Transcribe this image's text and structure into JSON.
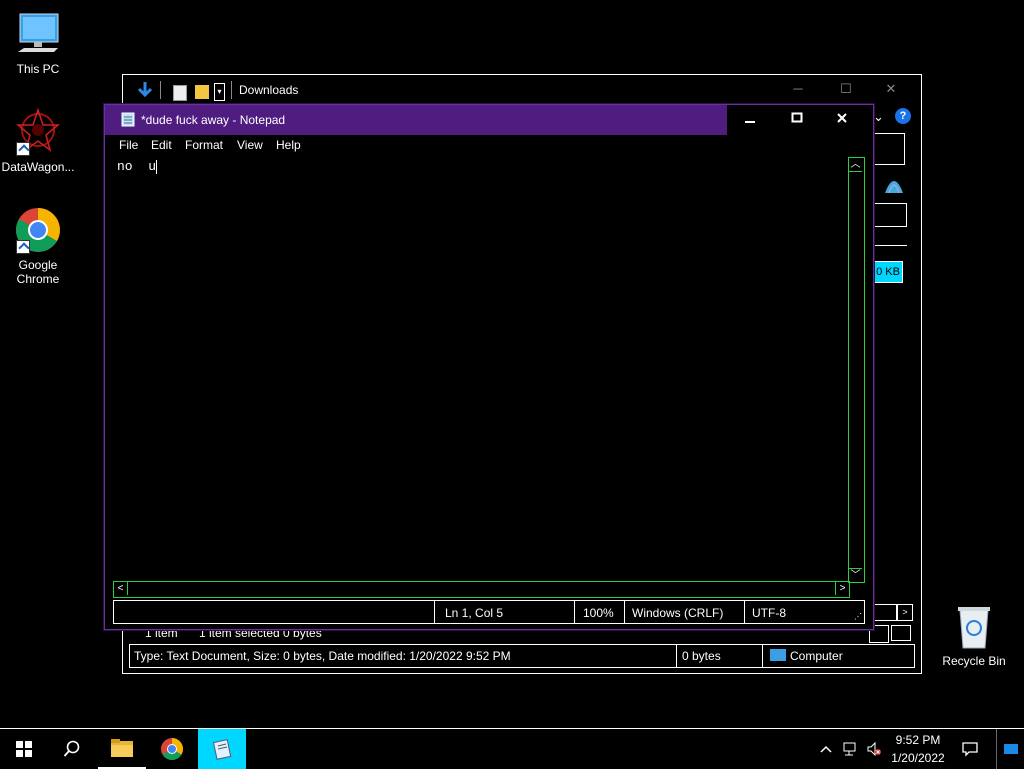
{
  "desktop": {
    "icons": [
      {
        "label": "This PC"
      },
      {
        "label": "DataWagon..."
      },
      {
        "label": "Google Chrome"
      },
      {
        "label": "Recycle Bin"
      }
    ]
  },
  "explorer": {
    "title": "Downloads",
    "size_badge": "0 KB",
    "status_left": "1 item",
    "status_selected": "1 item selected  0 bytes",
    "details": "Type: Text Document, Size: 0 bytes, Date modified: 1/20/2022 9:52 PM",
    "bytes": "0 bytes",
    "location": "Computer"
  },
  "notepad": {
    "title": "*dude fuck away - Notepad",
    "menu": [
      "File",
      "Edit",
      "Format",
      "View",
      "Help"
    ],
    "content": "no  u",
    "status": {
      "position": "Ln 1, Col 5",
      "zoom": "100%",
      "line_ending": "Windows (CRLF)",
      "encoding": "UTF-8"
    }
  },
  "taskbar": {
    "time": "9:52 PM",
    "date": "1/20/2022"
  },
  "colors": {
    "notepad_title": "#4f1d80",
    "scroll_border": "#2ecc40",
    "highlight": "#00d7ff"
  }
}
